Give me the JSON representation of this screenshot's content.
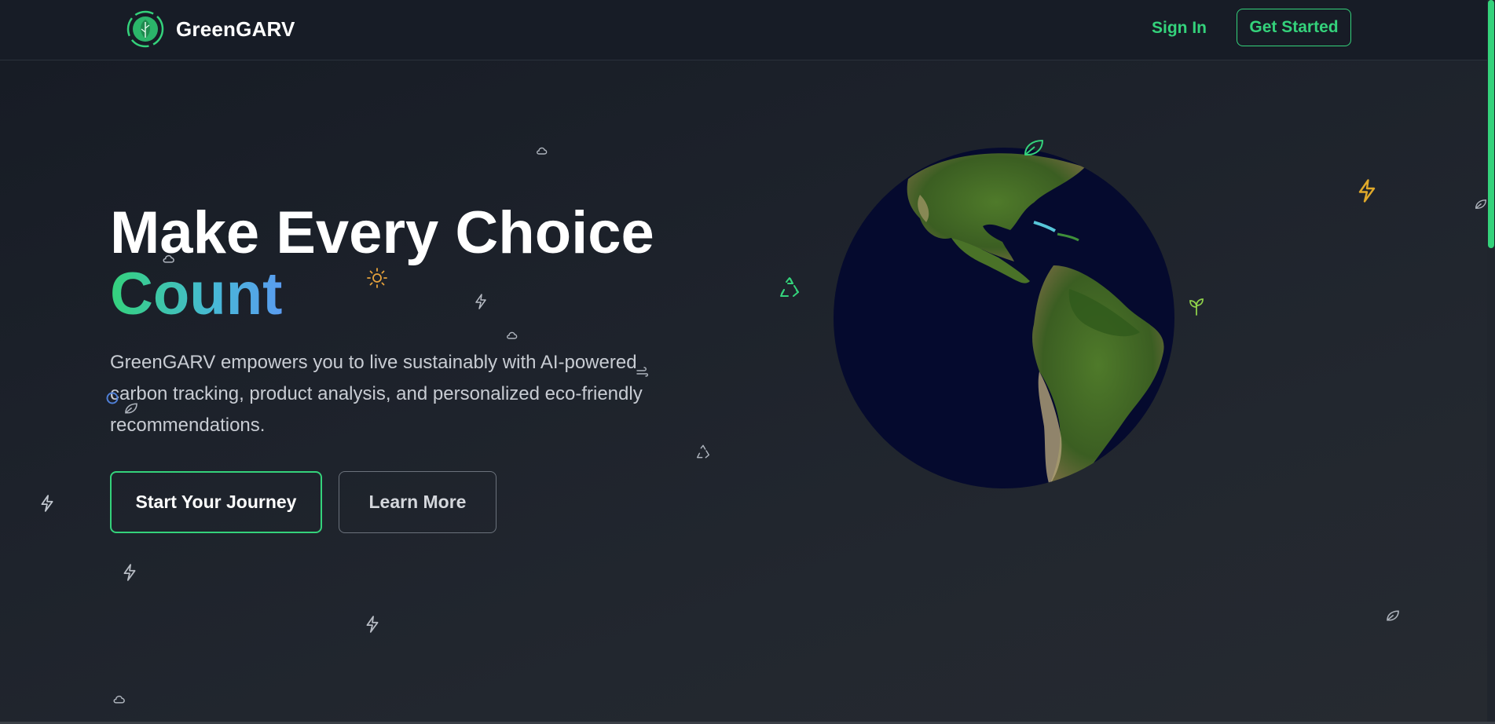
{
  "header": {
    "brand": "GreenGARV",
    "sign_in_label": "Sign In",
    "get_started_label": "Get Started"
  },
  "hero": {
    "title_line1": "Make Every Choice",
    "title_accent": "Count",
    "description": "GreenGARV empowers you to live sustainably with AI-powered carbon tracking, product analysis, and personalized eco-friendly recommendations.",
    "primary_button_label": "Start Your Journey",
    "secondary_button_label": "Learn More"
  },
  "colors": {
    "accent_green": "#34d27b",
    "accent_blue": "#5a9cf0",
    "background": "#1d222b",
    "header_background": "#171c26",
    "bolt_yellow": "#e0a92a",
    "sun_orange": "#e6a23c",
    "ocean": "#050a2e"
  },
  "icons": {
    "logo": "leaf-globe-icon",
    "floating": [
      "cloud-icon",
      "sun-icon",
      "bolt-icon",
      "recycle-icon",
      "leaf-icon",
      "sprout-icon",
      "wind-icon",
      "droplet-icon"
    ]
  }
}
